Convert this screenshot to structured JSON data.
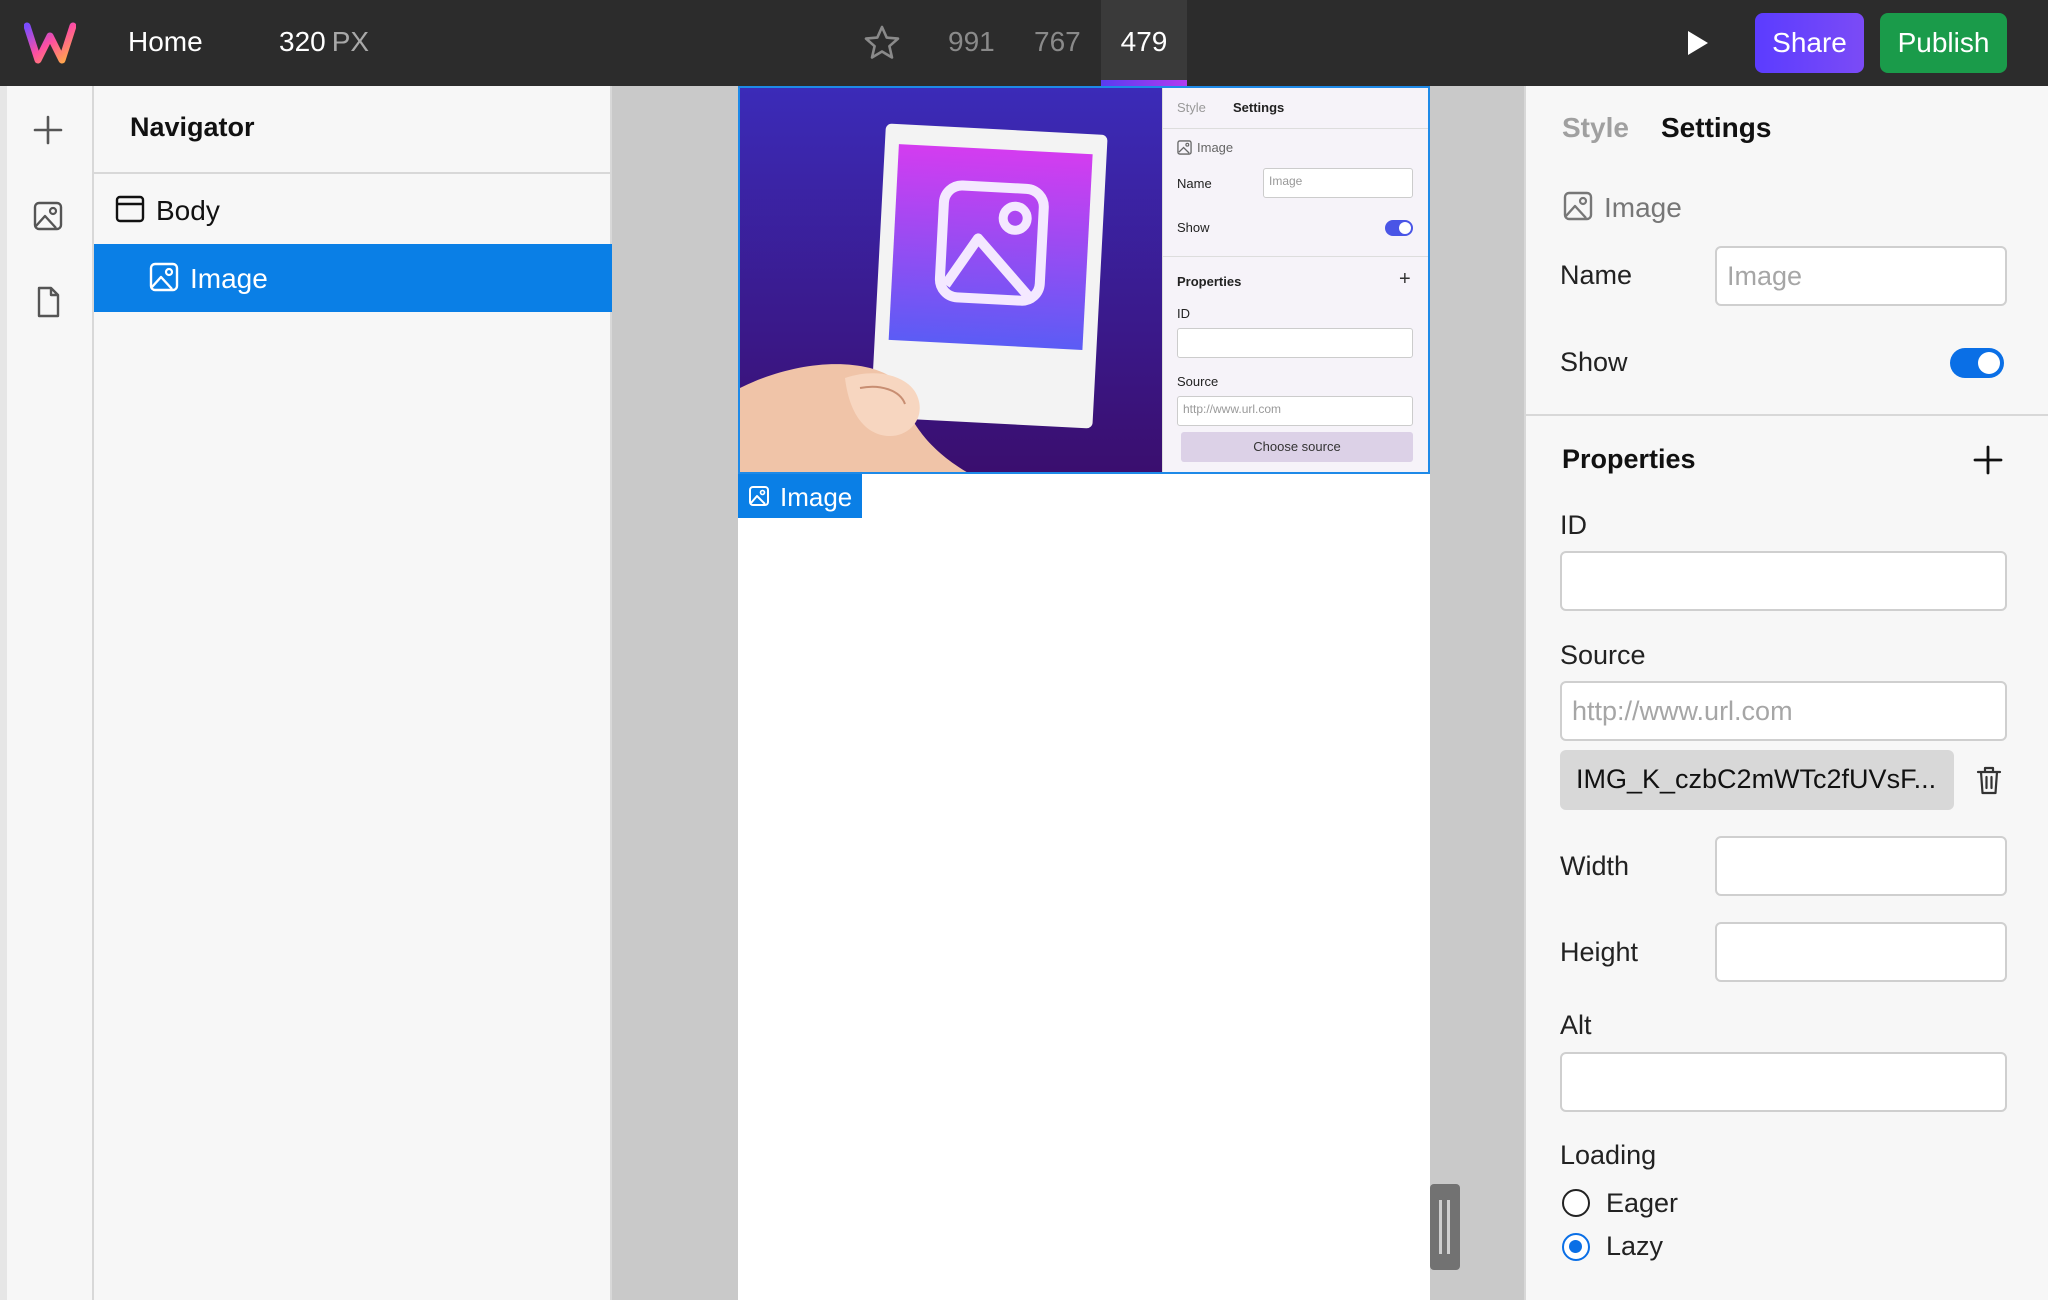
{
  "topbar": {
    "home": "Home",
    "width_value": "320",
    "width_unit": "PX",
    "breakpoints": [
      "991",
      "767",
      "479"
    ],
    "active_breakpoint": "479",
    "share": "Share",
    "publish": "Publish"
  },
  "navigator": {
    "title": "Navigator",
    "items": [
      {
        "label": "Body",
        "selected": false
      },
      {
        "label": "Image",
        "selected": true
      }
    ]
  },
  "canvas": {
    "selection_tag": "Image",
    "preview_panel": {
      "tabs": [
        "Style",
        "Settings"
      ],
      "type_label": "Image",
      "name_label": "Name",
      "name_placeholder": "Image",
      "show_label": "Show",
      "properties_label": "Properties",
      "id_label": "ID",
      "source_label": "Source",
      "source_placeholder": "http://www.url.com",
      "choose_source": "Choose source"
    }
  },
  "settings": {
    "tabs": {
      "style": "Style",
      "settings": "Settings"
    },
    "active_tab": "Settings",
    "element_type": "Image",
    "name_label": "Name",
    "name_placeholder": "Image",
    "show_label": "Show",
    "show_on": true,
    "properties_title": "Properties",
    "id_label": "ID",
    "id_value": "",
    "source_label": "Source",
    "source_placeholder": "http://www.url.com",
    "source_file": "IMG_K_czbC2mWTc2fUVsF...",
    "width_label": "Width",
    "height_label": "Height",
    "alt_label": "Alt",
    "loading_label": "Loading",
    "loading_options": [
      "Eager",
      "Lazy"
    ],
    "loading_selected": "Lazy"
  },
  "colors": {
    "accent": "#0a7fe6",
    "share": "#5b3cff",
    "publish": "#1a9b4a",
    "topbar": "#2c2c2c"
  }
}
